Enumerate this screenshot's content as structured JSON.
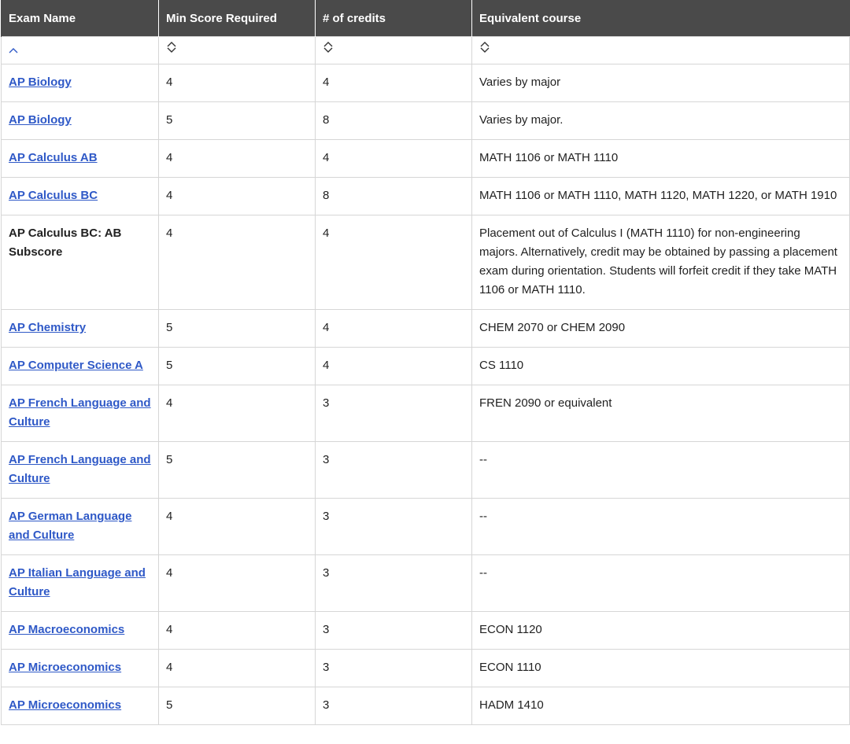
{
  "table": {
    "headers": [
      "Exam Name",
      "Min Score Required",
      "# of credits",
      "Equivalent course"
    ],
    "sort_icons": [
      "chevron-up-icon",
      "sort-icon",
      "sort-icon",
      "sort-icon"
    ],
    "rows": [
      {
        "exam": "AP Biology",
        "link": true,
        "min": "4",
        "credits": "4",
        "equiv": "Varies by major"
      },
      {
        "exam": "AP Biology",
        "link": true,
        "min": "5",
        "credits": "8",
        "equiv": "Varies by major."
      },
      {
        "exam": "AP Calculus AB",
        "link": true,
        "min": "4",
        "credits": "4",
        "equiv": "MATH 1106 or MATH 1110"
      },
      {
        "exam": "AP Calculus BC",
        "link": true,
        "min": "4",
        "credits": "8",
        "equiv": "MATH 1106 or MATH 1110, MATH 1120, MATH 1220, or MATH 1910"
      },
      {
        "exam": "AP Calculus BC: AB Subscore",
        "link": false,
        "min": "4",
        "credits": "4",
        "equiv": "Placement out of Calculus I (MATH 1110) for non-engineering majors. Alternatively, credit may be obtained by passing a placement exam during orientation. Students will forfeit credit if they take MATH 1106 or MATH 1110."
      },
      {
        "exam": "AP Chemistry",
        "link": true,
        "min": "5",
        "credits": "4",
        "equiv": "CHEM 2070 or CHEM 2090"
      },
      {
        "exam": "AP Computer Science A",
        "link": true,
        "min": "5",
        "credits": "4",
        "equiv": "CS 1110"
      },
      {
        "exam": "AP French Language and Culture",
        "link": true,
        "min": "4",
        "credits": "3",
        "equiv": "FREN 2090 or equivalent"
      },
      {
        "exam": "AP French Language and Culture",
        "link": true,
        "min": "5",
        "credits": "3",
        "equiv": "--"
      },
      {
        "exam": "AP German Language and Culture",
        "link": true,
        "min": "4",
        "credits": "3",
        "equiv": "--"
      },
      {
        "exam": "AP Italian Language and Culture",
        "link": true,
        "min": "4",
        "credits": "3",
        "equiv": "--"
      },
      {
        "exam": "AP Macroeconomics",
        "link": true,
        "min": "4",
        "credits": "3",
        "equiv": "ECON 1120"
      },
      {
        "exam": "AP Microeconomics",
        "link": true,
        "min": "4",
        "credits": "3",
        "equiv": "ECON 1110"
      },
      {
        "exam": "AP Microeconomics",
        "link": true,
        "min": "5",
        "credits": "3",
        "equiv": "HADM 1410"
      }
    ]
  },
  "colors": {
    "header_bg": "#4a4a4a",
    "link": "#2f59c7",
    "border": "#d6d6d6"
  }
}
